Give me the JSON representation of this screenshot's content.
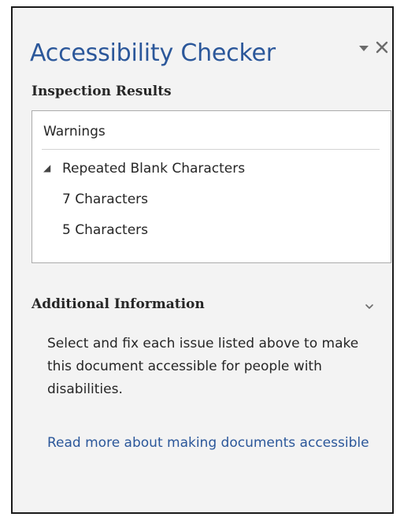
{
  "pane": {
    "title": "Accessibility Checker",
    "options_icon": "dropdown-arrow-icon",
    "close_icon": "close-icon",
    "accent_color": "#2b579a"
  },
  "inspection": {
    "heading": "Inspection Results",
    "group_label": "Warnings",
    "category": {
      "label": "Repeated Blank Characters",
      "expanded": true,
      "toggle_icon": "expanded-triangle-icon"
    },
    "issues": [
      {
        "label": "7 Characters"
      },
      {
        "label": "5 Characters"
      }
    ]
  },
  "additional_info": {
    "heading": "Additional Information",
    "collapse_icon": "chevron-down-icon",
    "description": "Select and fix each issue listed above to make this document accessible for people with disabilities.",
    "link_text": "Read more about making documents accessible"
  }
}
